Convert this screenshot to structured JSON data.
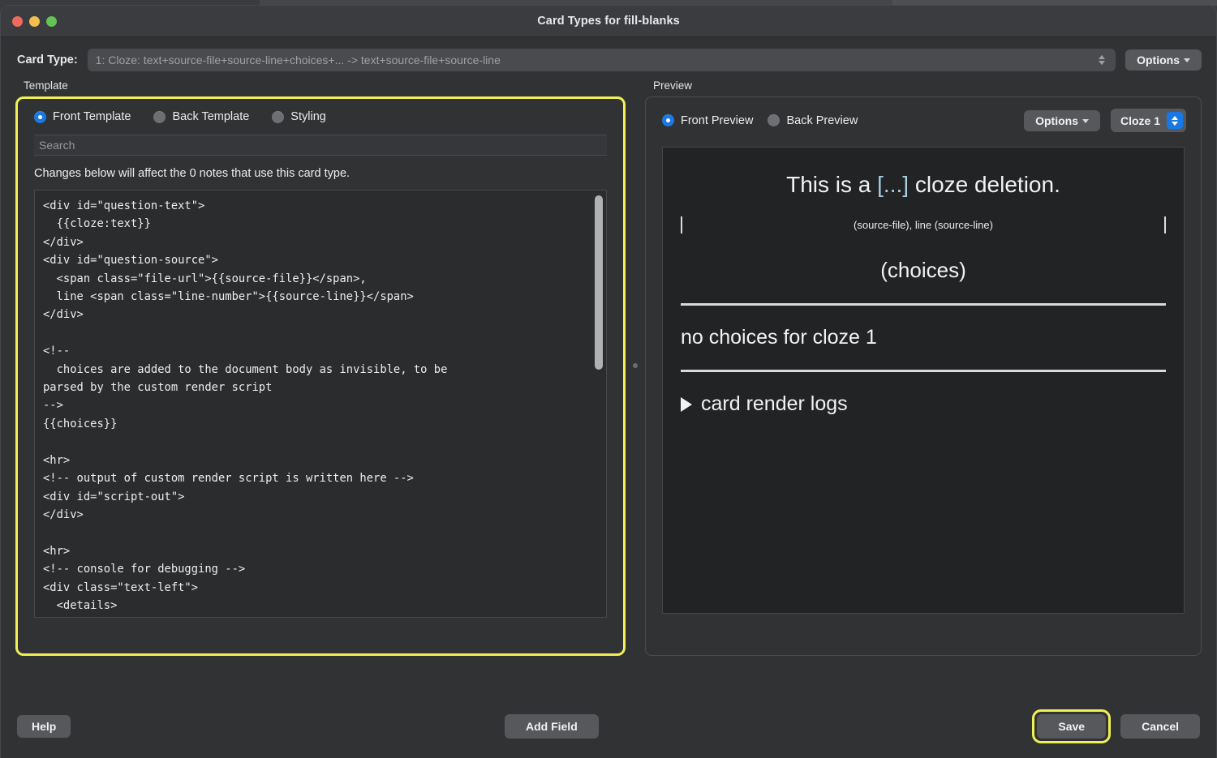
{
  "window": {
    "title": "Card Types for fill-blanks",
    "traffic_lights": [
      "close-red",
      "minimize-yellow",
      "maximize-green"
    ]
  },
  "header": {
    "card_type_label": "Card Type:",
    "card_type_value": "1: Cloze: text+source-file+source-line+choices+... -> text+source-file+source-line",
    "options_label": "Options"
  },
  "template_pane": {
    "caption": "Template",
    "radios": [
      {
        "label": "Front Template",
        "selected": true
      },
      {
        "label": "Back Template",
        "selected": false
      },
      {
        "label": "Styling",
        "selected": false
      }
    ],
    "search_placeholder": "Search",
    "search_value": "",
    "notes_notice": "Changes below will affect the 0 notes that use this card type.",
    "code": "<div id=\"question-text\">\n  {{cloze:text}}\n</div>\n<div id=\"question-source\">\n  <span class=\"file-url\">{{source-file}}</span>,\n  line <span class=\"line-number\">{{source-line}}</span>\n</div>\n\n<!--\n  choices are added to the document body as invisible, to be\nparsed by the custom render script\n-->\n{{choices}}\n\n<hr>\n<!-- output of custom render script is written here -->\n<div id=\"script-out\">\n</div>\n\n<hr>\n<!-- console for debugging -->\n<div class=\"text-left\">\n  <details>"
  },
  "preview_pane": {
    "caption": "Preview",
    "radios": [
      {
        "label": "Front Preview",
        "selected": true
      },
      {
        "label": "Back Preview",
        "selected": false
      }
    ],
    "options_label": "Options",
    "cloze_selector_value": "Cloze 1",
    "card": {
      "question_before": "This is a ",
      "question_cloze": "[...]",
      "question_after": " cloze deletion.",
      "source_line": "(source-file), line (source-line)",
      "choices_placeholder": "(choices)",
      "no_choices_text": "no choices for cloze 1",
      "render_logs_label": "card render logs"
    }
  },
  "footer": {
    "help_label": "Help",
    "add_field_label": "Add Field",
    "save_label": "Save",
    "cancel_label": "Cancel"
  },
  "colors": {
    "highlight_ring": "#f2ef55",
    "accent_blue": "#1a78e5",
    "cloze_blue": "#a9cfe2",
    "window_bg": "#313234",
    "preview_bg": "#222325"
  }
}
